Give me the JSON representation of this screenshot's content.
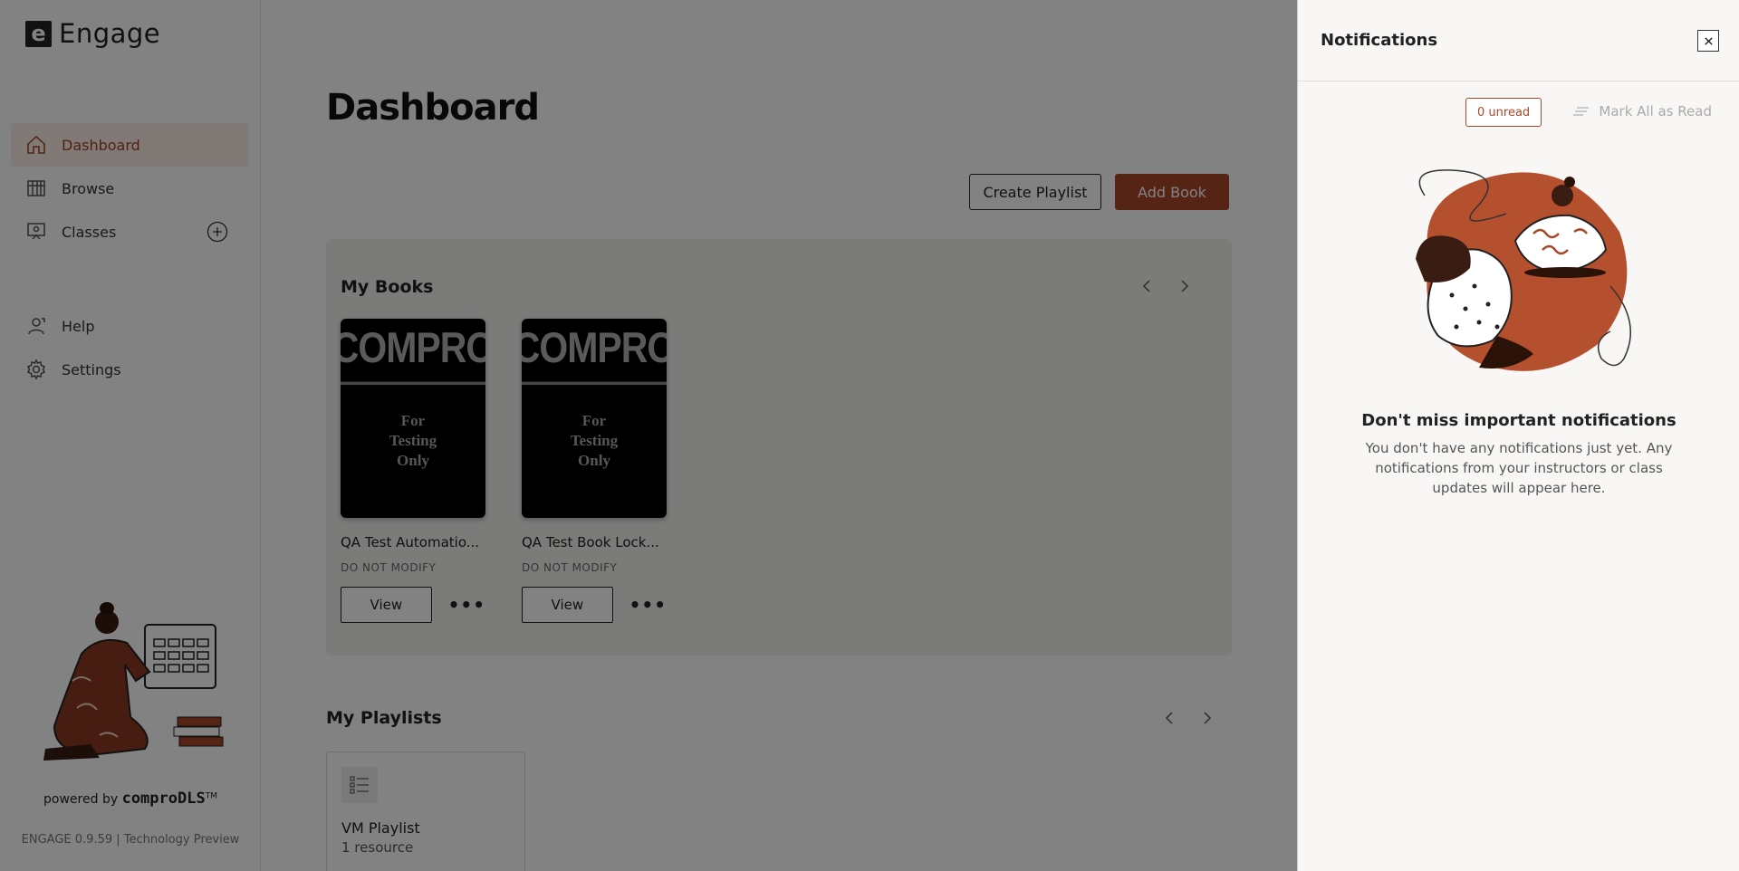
{
  "app": {
    "logo_letter": "e",
    "name": "Engage"
  },
  "sidebar": {
    "items": [
      {
        "label": "Dashboard",
        "icon": "home-icon",
        "active": true
      },
      {
        "label": "Browse",
        "icon": "library-icon"
      },
      {
        "label": "Classes",
        "icon": "classes-icon"
      },
      {
        "label": "Help",
        "icon": "help-icon"
      },
      {
        "label": "Settings",
        "icon": "gear-icon"
      }
    ],
    "powered_by": "powered by",
    "brand": "comproDLS",
    "trademark": "TM",
    "version": "ENGAGE 0.9.59 | Technology Preview"
  },
  "main": {
    "title": "Dashboard",
    "create_playlist": "Create Playlist",
    "add_book": "Add Book",
    "my_books": {
      "title": "My Books",
      "books": [
        {
          "cover_brand": "COMPRO",
          "cover_text": [
            "For",
            "Testing",
            "Only"
          ],
          "title": "QA Test Automatio...",
          "subtitle": "DO NOT MODIFY",
          "view": "View"
        },
        {
          "cover_brand": "COMPRO",
          "cover_text": [
            "For",
            "Testing",
            "Only"
          ],
          "title": "QA Test Book Lock...",
          "subtitle": "DO NOT MODIFY",
          "view": "View"
        }
      ]
    },
    "my_playlists": {
      "title": "My Playlists",
      "playlists": [
        {
          "name": "VM Playlist",
          "count": "1 resource"
        }
      ]
    }
  },
  "notifications": {
    "title": "Notifications",
    "unread": "0 unread",
    "mark_all": "Mark All as Read",
    "empty_title": "Don't miss important notifications",
    "empty_text": "You don't have any notifications just yet. Any notifications from your instructors or class updates will appear here."
  },
  "colors": {
    "accent": "#a8472a",
    "overlay": "rgba(0,0,0,0.49)",
    "active_bg": "#fbeee8"
  }
}
